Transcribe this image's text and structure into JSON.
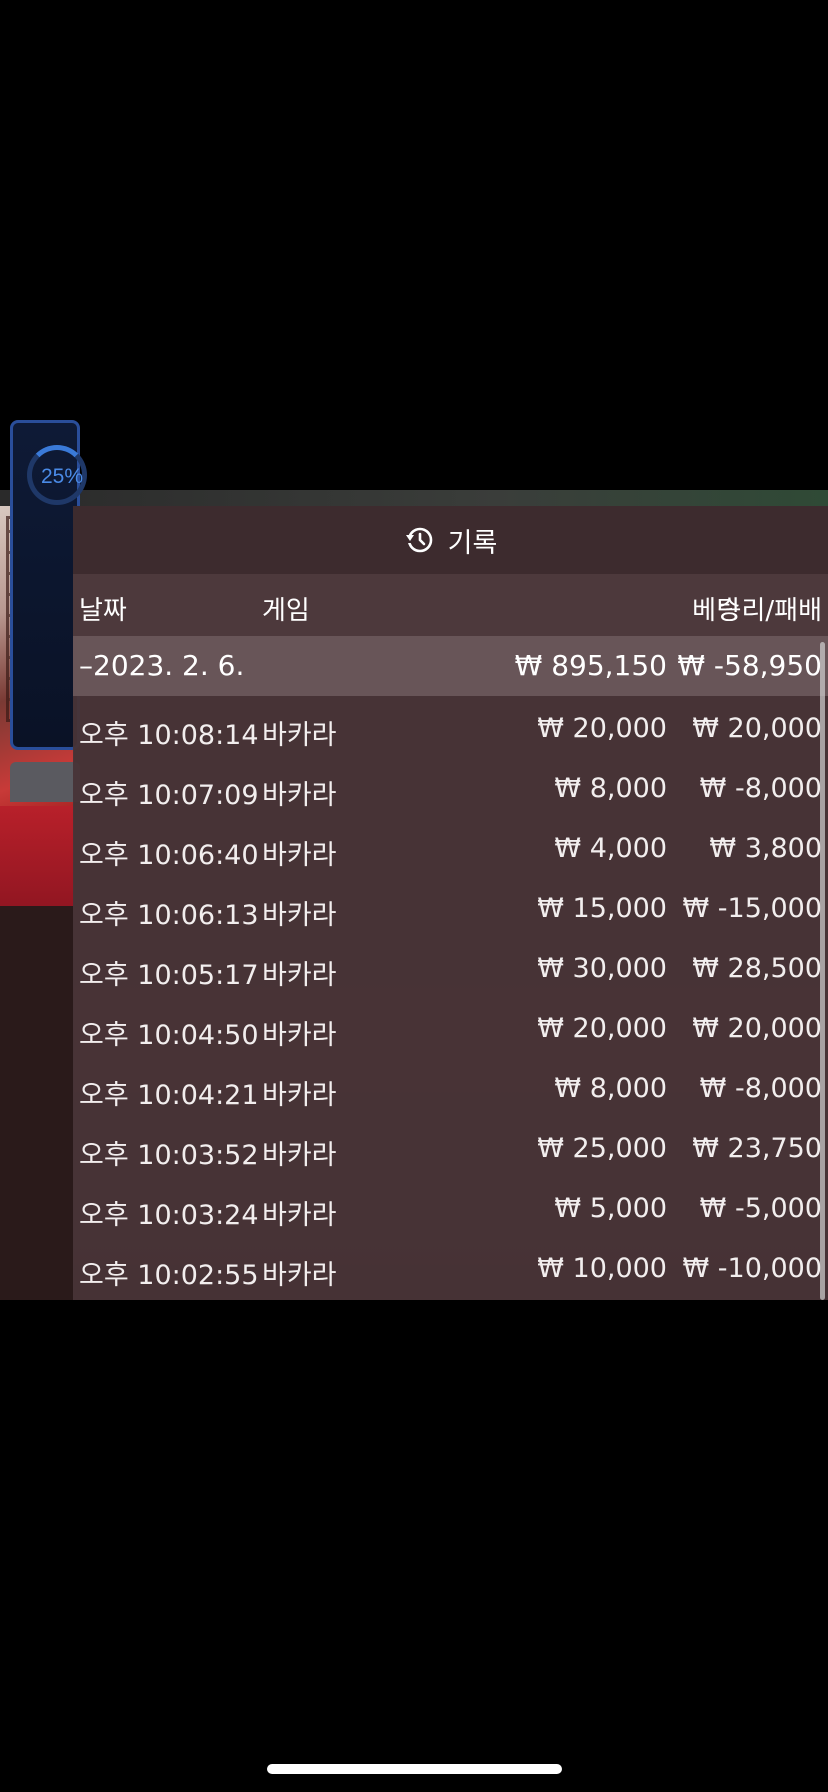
{
  "panel": {
    "title": "기록",
    "icon": "history-icon"
  },
  "columns": {
    "date": "날짜",
    "game": "게임",
    "bet": "베팅",
    "win_loss": "승리/패배"
  },
  "date_group": {
    "label": "–2023. 2. 6.",
    "bet_total": "₩ 895,150",
    "win_loss_total": "₩ -58,950"
  },
  "rows": [
    {
      "time": "오후 10:08:14",
      "game": "바카라",
      "bet": "₩ 20,000",
      "result": "₩ 20,000"
    },
    {
      "time": "오후 10:07:09",
      "game": "바카라",
      "bet": "₩ 8,000",
      "result": "₩ -8,000"
    },
    {
      "time": "오후 10:06:40",
      "game": "바카라",
      "bet": "₩ 4,000",
      "result": "₩ 3,800"
    },
    {
      "time": "오후 10:06:13",
      "game": "바카라",
      "bet": "₩ 15,000",
      "result": "₩ -15,000"
    },
    {
      "time": "오후 10:05:17",
      "game": "바카라",
      "bet": "₩ 30,000",
      "result": "₩ 28,500"
    },
    {
      "time": "오후 10:04:50",
      "game": "바카라",
      "bet": "₩ 20,000",
      "result": "₩ 20,000"
    },
    {
      "time": "오후 10:04:21",
      "game": "바카라",
      "bet": "₩ 8,000",
      "result": "₩ -8,000"
    },
    {
      "time": "오후 10:03:52",
      "game": "바카라",
      "bet": "₩ 25,000",
      "result": "₩ 23,750"
    },
    {
      "time": "오후 10:03:24",
      "game": "바카라",
      "bet": "₩ 5,000",
      "result": "₩ -5,000"
    },
    {
      "time": "오후 10:02:55",
      "game": "바카라",
      "bet": "₩ 10,000",
      "result": "₩ -10,000"
    }
  ],
  "side_widget": {
    "percent": "25%"
  }
}
